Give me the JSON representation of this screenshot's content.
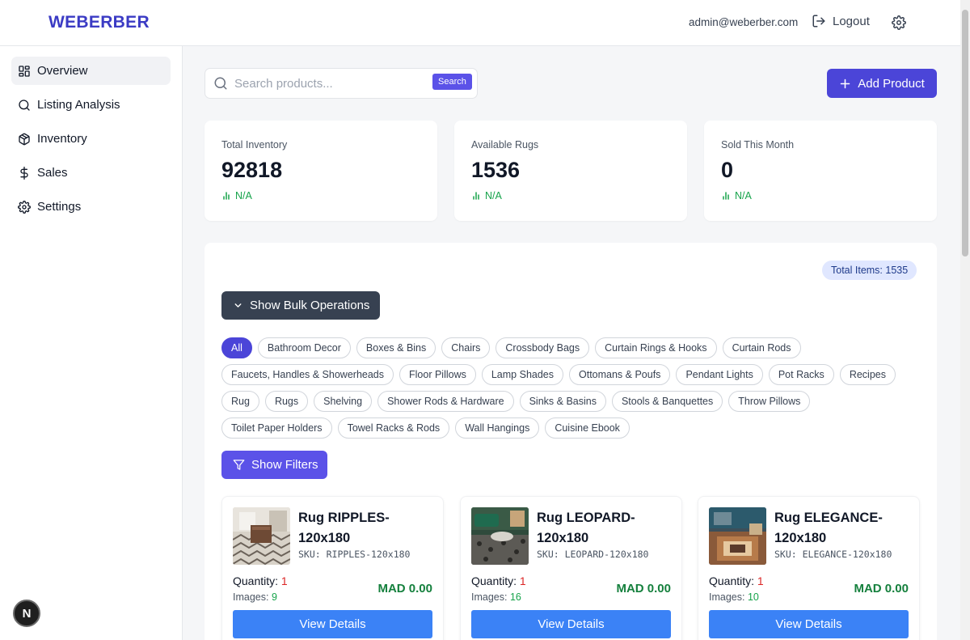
{
  "header": {
    "logo": "WEBERBER",
    "user_email": "admin@weberber.com",
    "logout_label": "Logout"
  },
  "sidebar": {
    "items": [
      {
        "label": "Overview",
        "icon": "dashboard-icon",
        "active": true
      },
      {
        "label": "Listing Analysis",
        "icon": "search-icon"
      },
      {
        "label": "Inventory",
        "icon": "package-icon"
      },
      {
        "label": "Sales",
        "icon": "dollar-icon"
      },
      {
        "label": "Settings",
        "icon": "gear-icon"
      }
    ],
    "fab_label": "N"
  },
  "toolbar": {
    "search_placeholder": "Search products...",
    "search_button": "Search",
    "add_product": "Add Product"
  },
  "stats": [
    {
      "label": "Total Inventory",
      "value": "92818",
      "trend": "N/A"
    },
    {
      "label": "Available Rugs",
      "value": "1536",
      "trend": "N/A"
    },
    {
      "label": "Sold This Month",
      "value": "0",
      "trend": "N/A"
    }
  ],
  "panel": {
    "total_items": "Total Items: 1535",
    "bulk_button": "Show Bulk Operations",
    "filters_button": "Show Filters",
    "categories": [
      "All",
      "Bathroom Decor",
      "Boxes & Bins",
      "Chairs",
      "Crossbody Bags",
      "Curtain Rings & Hooks",
      "Curtain Rods",
      "Faucets, Handles & Showerheads",
      "Floor Pillows",
      "Lamp Shades",
      "Ottomans & Poufs",
      "Pendant Lights",
      "Pot Racks",
      "Recipes",
      "Rug",
      "Rugs",
      "Shelving",
      "Shower Rods & Hardware",
      "Sinks & Basins",
      "Stools & Banquettes",
      "Throw Pillows",
      "Toilet Paper Holders",
      "Towel Racks & Rods",
      "Wall Hangings",
      "Cuisine Ebook"
    ],
    "active_category": "All"
  },
  "products": [
    {
      "title": "Rug RIPPLES-120x180",
      "sku": "SKU: RIPPLES-120x180",
      "quantity_label": "Quantity:",
      "quantity": "1",
      "images_label": "Images:",
      "images": "9",
      "price": "MAD 0.00",
      "button": "View Details"
    },
    {
      "title": "Rug LEOPARD-120x180",
      "sku": "SKU: LEOPARD-120x180",
      "quantity_label": "Quantity:",
      "quantity": "1",
      "images_label": "Images:",
      "images": "16",
      "price": "MAD 0.00",
      "button": "View Details"
    },
    {
      "title": "Rug ELEGANCE-120x180",
      "sku": "SKU: ELEGANCE-120x180",
      "quantity_label": "Quantity:",
      "quantity": "1",
      "images_label": "Images:",
      "images": "10",
      "price": "MAD 0.00",
      "button": "View Details"
    }
  ],
  "colors": {
    "brand": "#3b3bc4",
    "primary": "#4b45d8",
    "view_button": "#3b82f6",
    "positive": "#16a34a",
    "negative": "#dc2626"
  }
}
